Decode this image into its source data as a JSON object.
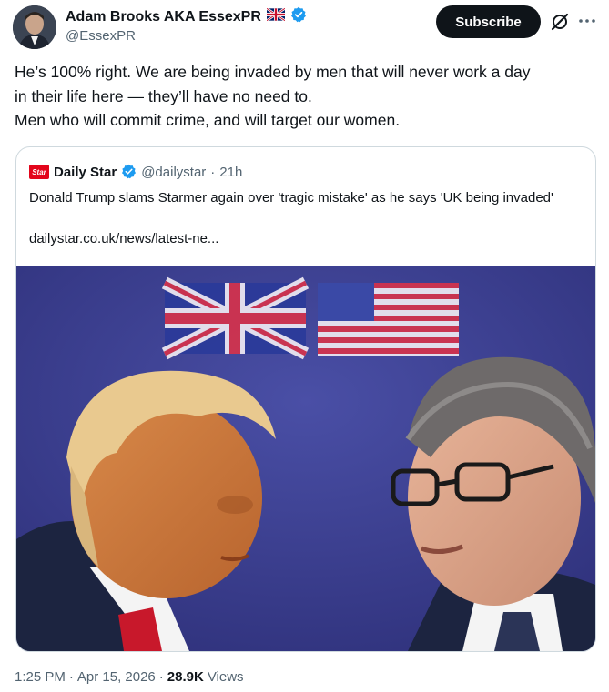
{
  "author": {
    "name": "Adam Brooks AKA EssexPR",
    "flag": "🇬🇧",
    "handle": "@EssexPR",
    "verified_icon": "verified-badge-icon"
  },
  "actions": {
    "subscribe_label": "Subscribe",
    "grok_icon": "grok-icon",
    "more_icon": "more-icon"
  },
  "tweet": {
    "lines": [
      "He’s 100% right. We are being invaded by men that will never work a day",
      "in their life here — they’ll have no need to.",
      "Men who will commit crime, and will target our women."
    ]
  },
  "quoted": {
    "logo_text": "Star",
    "name": "Daily Star",
    "handle": "@dailystar",
    "separator": "·",
    "time": "21h",
    "text": "Donald Trump slams Starmer again over 'tragic mistake' as he says 'UK being invaded'",
    "url": "dailystar.co.uk/news/latest-ne..."
  },
  "meta": {
    "time": "1:25 PM",
    "separator": "·",
    "date": "Apr 15, 2026",
    "dot": "·",
    "views_count": "28.9K",
    "views_label": "Views"
  },
  "colors": {
    "accent_blue": "#1d9bf0",
    "daily_star_red": "#e3051b",
    "photo_bg": "#3c3f8f"
  }
}
